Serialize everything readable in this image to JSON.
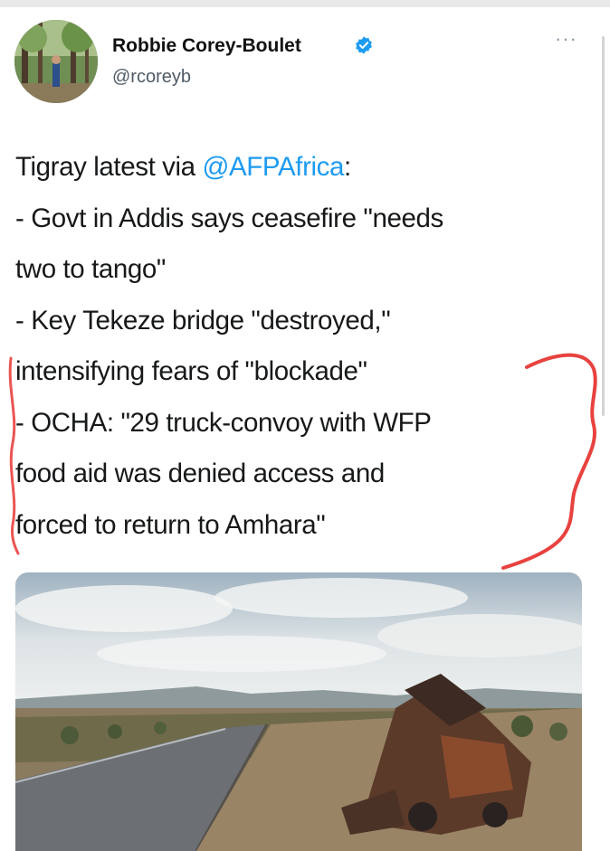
{
  "tweet": {
    "author": {
      "display_name": "Robbie Corey-Boulet",
      "handle": "@rcoreyb",
      "verified": true
    },
    "more_label": "···",
    "text": {
      "line1_prefix": "Tigray latest via ",
      "line1_mention": "@AFPAfrica",
      "line1_suffix": ":",
      "line2": "- Govt in Addis says ceasefire \"needs",
      "line3": "two to tango\"",
      "line4": "- Key Tekeze bridge \"destroyed,\"",
      "line5": "intensifying fears of \"blockade\"",
      "line6": "- OCHA: \"29 truck-convoy with WFP",
      "line7": "food aid was denied access and",
      "line8": "forced to return to Amhara\""
    },
    "annotation_color": "#e8423f",
    "mention_color": "#1d9bf0",
    "verified_color": "#1d9bf0"
  }
}
